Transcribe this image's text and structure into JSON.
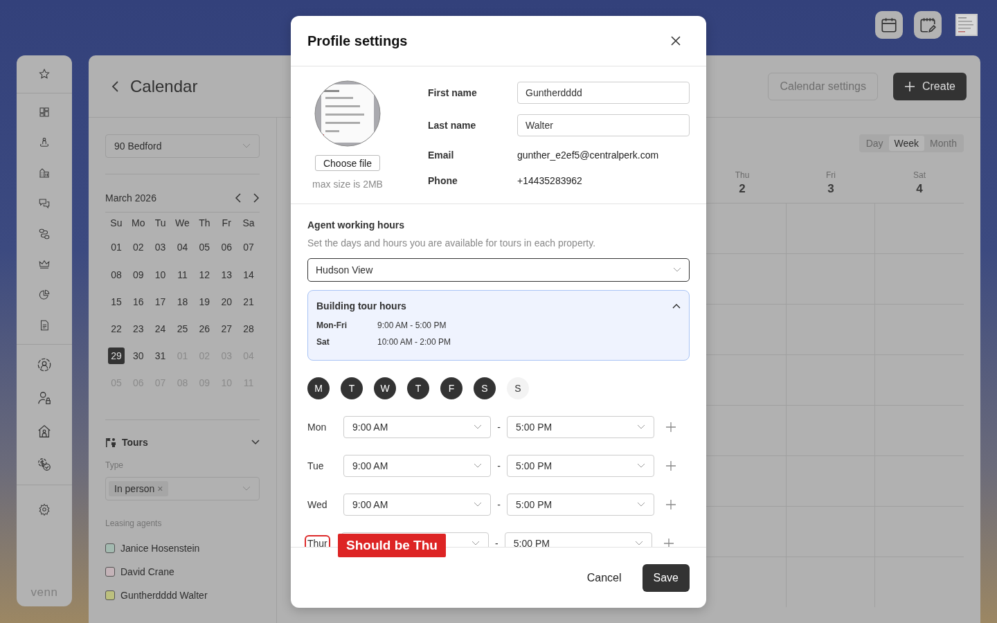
{
  "sidebar": {
    "logo": "venn"
  },
  "calendar_panel": {
    "title": "Calendar",
    "property": "90 Bedford",
    "month": "March 2026",
    "weekdays": [
      "Su",
      "Mo",
      "Tu",
      "We",
      "Th",
      "Fr",
      "Sa"
    ],
    "days": [
      {
        "label": "01",
        "in_month": true,
        "selected": false
      },
      {
        "label": "02",
        "in_month": true,
        "selected": false
      },
      {
        "label": "03",
        "in_month": true,
        "selected": false
      },
      {
        "label": "04",
        "in_month": true,
        "selected": false
      },
      {
        "label": "05",
        "in_month": true,
        "selected": false
      },
      {
        "label": "06",
        "in_month": true,
        "selected": false
      },
      {
        "label": "07",
        "in_month": true,
        "selected": false
      },
      {
        "label": "08",
        "in_month": true,
        "selected": false
      },
      {
        "label": "09",
        "in_month": true,
        "selected": false
      },
      {
        "label": "10",
        "in_month": true,
        "selected": false
      },
      {
        "label": "11",
        "in_month": true,
        "selected": false
      },
      {
        "label": "12",
        "in_month": true,
        "selected": false
      },
      {
        "label": "13",
        "in_month": true,
        "selected": false
      },
      {
        "label": "14",
        "in_month": true,
        "selected": false
      },
      {
        "label": "15",
        "in_month": true,
        "selected": false
      },
      {
        "label": "16",
        "in_month": true,
        "selected": false
      },
      {
        "label": "17",
        "in_month": true,
        "selected": false
      },
      {
        "label": "18",
        "in_month": true,
        "selected": false
      },
      {
        "label": "19",
        "in_month": true,
        "selected": false
      },
      {
        "label": "20",
        "in_month": true,
        "selected": false
      },
      {
        "label": "21",
        "in_month": true,
        "selected": false
      },
      {
        "label": "22",
        "in_month": true,
        "selected": false
      },
      {
        "label": "23",
        "in_month": true,
        "selected": false
      },
      {
        "label": "24",
        "in_month": true,
        "selected": false
      },
      {
        "label": "25",
        "in_month": true,
        "selected": false
      },
      {
        "label": "26",
        "in_month": true,
        "selected": false
      },
      {
        "label": "27",
        "in_month": true,
        "selected": false
      },
      {
        "label": "28",
        "in_month": true,
        "selected": false
      },
      {
        "label": "29",
        "in_month": true,
        "selected": true
      },
      {
        "label": "30",
        "in_month": true,
        "selected": false
      },
      {
        "label": "31",
        "in_month": true,
        "selected": false
      },
      {
        "label": "01",
        "in_month": false,
        "selected": false
      },
      {
        "label": "02",
        "in_month": false,
        "selected": false
      },
      {
        "label": "03",
        "in_month": false,
        "selected": false
      },
      {
        "label": "04",
        "in_month": false,
        "selected": false
      },
      {
        "label": "05",
        "in_month": false,
        "selected": false
      },
      {
        "label": "06",
        "in_month": false,
        "selected": false
      },
      {
        "label": "07",
        "in_month": false,
        "selected": false
      },
      {
        "label": "08",
        "in_month": false,
        "selected": false
      },
      {
        "label": "09",
        "in_month": false,
        "selected": false
      },
      {
        "label": "10",
        "in_month": false,
        "selected": false
      },
      {
        "label": "11",
        "in_month": false,
        "selected": false
      }
    ],
    "tours": {
      "title": "Tours",
      "expanded": true,
      "type_label": "Type",
      "type_tags": [
        {
          "label": "In person",
          "remove": "×"
        }
      ]
    },
    "leasing_agents": {
      "label": "Leasing agents",
      "agents": [
        {
          "name": "Janice Hosenstein",
          "checked": false,
          "color": "#a3bab0"
        },
        {
          "name": "David Crane",
          "checked": false,
          "color": "#c4b3b8"
        },
        {
          "name": "Guntherdddd Walter",
          "checked": false,
          "color": "#bcc07e"
        }
      ]
    }
  },
  "toolbar": {
    "settings_button": "Calendar settings",
    "create_button": "Create"
  },
  "view_tabs": [
    {
      "label": "Day",
      "selected": false
    },
    {
      "label": "Week",
      "selected": true
    },
    {
      "label": "Month",
      "selected": false
    }
  ],
  "week_columns": [
    {
      "day": "Thu",
      "date": "2"
    },
    {
      "day": "Fri",
      "date": "3"
    },
    {
      "day": "Sat",
      "date": "4"
    }
  ],
  "modal": {
    "title": "Profile settings",
    "choose_file": "Choose file",
    "size_hint": "max size is 2MB",
    "profile_fields": [
      {
        "kind": "input",
        "label": "First name",
        "value": "Guntherdddd"
      },
      {
        "kind": "input",
        "label": "Last name",
        "value": "Walter"
      },
      {
        "kind": "text",
        "label": "Email",
        "value": "gunther_e2ef5@centralperk.com"
      },
      {
        "kind": "text",
        "label": "Phone",
        "value": "+14435283962"
      }
    ],
    "working_hours": {
      "title": "Agent working hours",
      "subtitle": "Set the days and hours you are available for tours in each property.",
      "property": "Hudson View",
      "building_hours": {
        "title": "Building tour hours",
        "expanded": true,
        "rows": [
          {
            "days": "Mon-Fri",
            "hours": "9:00 AM - 5:00 PM"
          },
          {
            "days": "Sat",
            "hours": "10:00 AM - 2:00 PM"
          }
        ]
      },
      "day_chips": [
        {
          "label": "M",
          "selected": true
        },
        {
          "label": "T",
          "selected": true
        },
        {
          "label": "W",
          "selected": true
        },
        {
          "label": "T",
          "selected": true
        },
        {
          "label": "F",
          "selected": true
        },
        {
          "label": "S",
          "selected": true
        },
        {
          "label": "S",
          "selected": false
        }
      ],
      "rows": [
        {
          "day": "Mon",
          "start": "9:00 AM",
          "separator": "-",
          "end": "5:00 PM",
          "flagged": false
        },
        {
          "day": "Tue",
          "start": "9:00 AM",
          "separator": "-",
          "end": "5:00 PM",
          "flagged": false
        },
        {
          "day": "Wed",
          "start": "9:00 AM",
          "separator": "-",
          "end": "5:00 PM",
          "flagged": false
        },
        {
          "day": "Thur",
          "separator": "-",
          "end": "5:00 PM",
          "flagged": true,
          "note": "Should be Thu"
        }
      ]
    },
    "cancel_button": "Cancel",
    "save_button": "Save"
  }
}
